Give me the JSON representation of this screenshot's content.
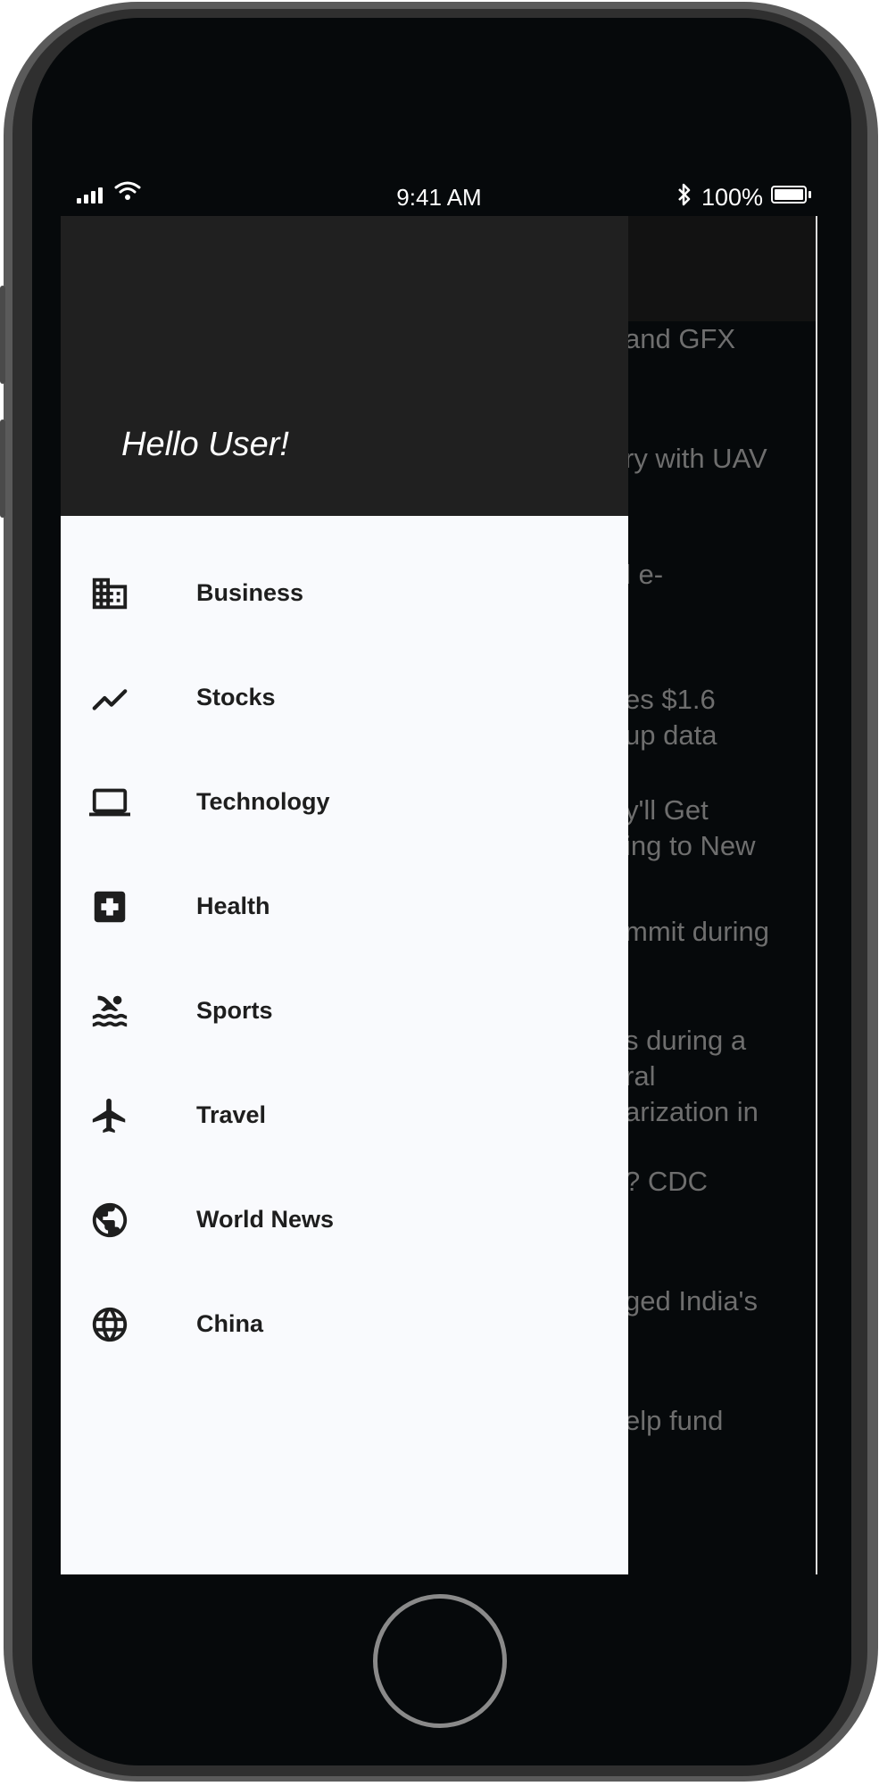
{
  "status_bar": {
    "time": "9:41 AM",
    "battery": "100%",
    "icons": [
      "signal-icon",
      "wifi-icon",
      "bluetooth-icon",
      "battery-icon"
    ]
  },
  "drawer": {
    "greeting": "Hello User!",
    "header_color": "#202020",
    "background_color": "#f9fafd",
    "items": [
      {
        "label": "Business",
        "icon": "business-building-icon"
      },
      {
        "label": "Stocks",
        "icon": "trending-line-icon"
      },
      {
        "label": "Technology",
        "icon": "laptop-icon"
      },
      {
        "label": "Health",
        "icon": "medical-cross-icon"
      },
      {
        "label": "Sports",
        "icon": "swimming-icon"
      },
      {
        "label": "Travel",
        "icon": "airplane-icon"
      },
      {
        "label": "World News",
        "icon": "earth-icon"
      },
      {
        "label": "China",
        "icon": "globe-grid-icon"
      }
    ]
  },
  "background_news": {
    "headline_fragments": [
      {
        "lines": [
          "and GFX"
        ]
      },
      {
        "lines": [
          "ry with UAV"
        ]
      },
      {
        "lines": [
          "l e-"
        ]
      },
      {
        "lines": [
          "es $1.6",
          "up data"
        ]
      },
      {
        "lines": [
          "y'll Get",
          "ing to New"
        ]
      },
      {
        "lines": [
          "mmit during"
        ]
      },
      {
        "lines": [
          "s during a",
          "ral",
          "arization in"
        ]
      },
      {
        "lines": [
          "? CDC"
        ]
      },
      {
        "lines": [
          "ged India's"
        ]
      },
      {
        "lines": [
          "elp fund"
        ]
      }
    ]
  }
}
